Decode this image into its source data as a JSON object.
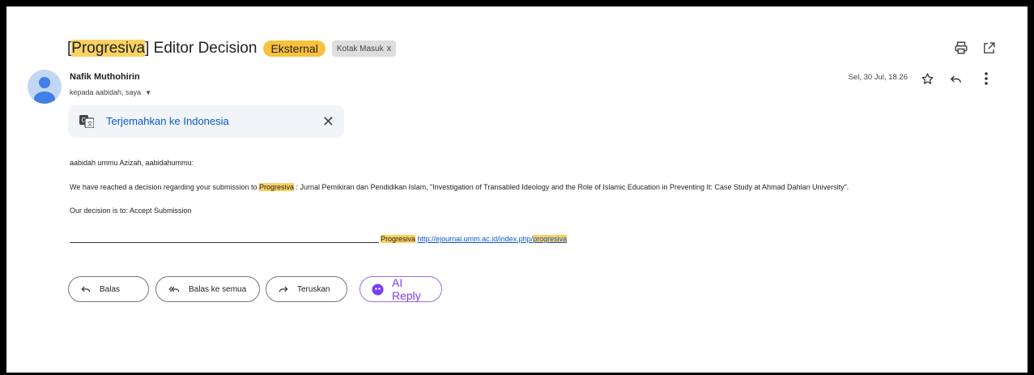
{
  "subject": {
    "prefix": "[",
    "highlight": "Progresiva",
    "rest": "] Editor Decision",
    "label_external": "Eksternal",
    "label_inbox": "Kotak Masuk",
    "label_inbox_close": "x"
  },
  "sender": {
    "name": "Nafik Muthohirin",
    "recipients": "kepada aabidah, saya",
    "date": "Sel, 30 Jul, 18.26"
  },
  "translate": {
    "label": "Terjemahkan ke Indonesia"
  },
  "body": {
    "greeting": "aabidah ummu Azizah, aabidahummu:",
    "line1_pre": "We have reached a decision regarding your submission to ",
    "line1_hl": "Progresiva",
    "line1_post": " : Jurnal Pemikiran dan Pendidikan Islam, \"Investigation of Transabled Ideology and the Role of Islamic Education in Preventing It: Case Study at Ahmad Dahlan University\".",
    "decision": "Our decision is to: Accept Submission",
    "sig_journal": "Progresiva",
    "sig_link_pre": "http://ejournal.umm.ac.id/index.php/",
    "sig_link_hl": "progresiva"
  },
  "actions": {
    "reply": "Balas",
    "reply_all": "Balas ke semua",
    "forward": "Teruskan",
    "ai_reply": "AI Reply"
  },
  "colors": {
    "highlight": "#fcd163",
    "external_label": "#f9c23c",
    "link": "#0b57d0",
    "ai_accent": "#7b3ff2"
  },
  "icons": {
    "print": "print-icon",
    "open_new": "open-in-new-window-icon",
    "star": "star-icon",
    "reply": "reply-icon",
    "more": "more-vert-icon",
    "translate": "translate-icon",
    "close": "close-icon",
    "reply_all": "reply-all-icon",
    "forward": "forward-icon",
    "ai": "ai-sparkle-icon"
  }
}
